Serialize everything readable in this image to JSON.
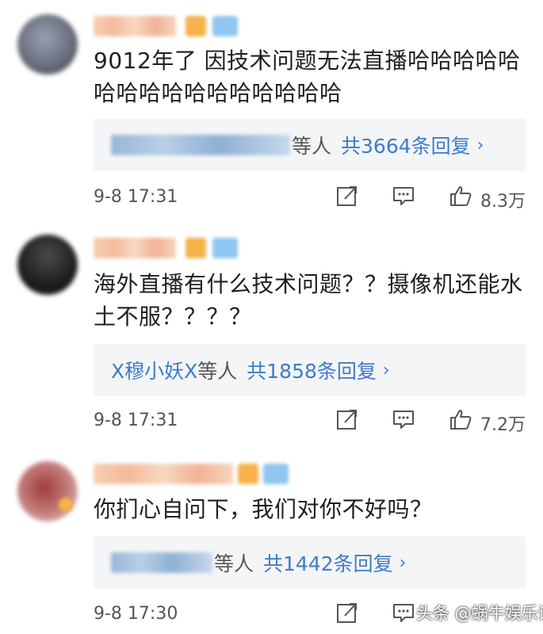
{
  "comments": [
    {
      "text": "9012年了 因技术问题无法直播哈哈哈哈哈哈哈哈哈哈哈哈哈哈哈哈",
      "reply_name": "",
      "reply_deng": "等人",
      "reply_count": "共3664条回复",
      "reply_chevron": "›",
      "time": "9-8 17:31",
      "likes": "8.3万"
    },
    {
      "text": "海外直播有什么技术问题？？摄像机还能水土不服？？？？",
      "reply_name": "X穆小妖X",
      "reply_deng": "等人",
      "reply_count": "共1858条回复",
      "reply_chevron": "›",
      "time": "9-8 17:31",
      "likes": "7.2万"
    },
    {
      "text": "你扪心自问下，我们对你不好吗？",
      "reply_name": "",
      "reply_deng": "等人",
      "reply_count": "共1442条回复",
      "reply_chevron": "›",
      "time": "9-8 17:30",
      "likes": ""
    }
  ],
  "watermark": "头条 @蜗牛娱乐话",
  "colors": {
    "link": "#3d7cc9",
    "reply_bg": "#f4f5f7",
    "meta": "#555555"
  },
  "icons": [
    "share-icon",
    "comment-icon",
    "like-icon"
  ]
}
